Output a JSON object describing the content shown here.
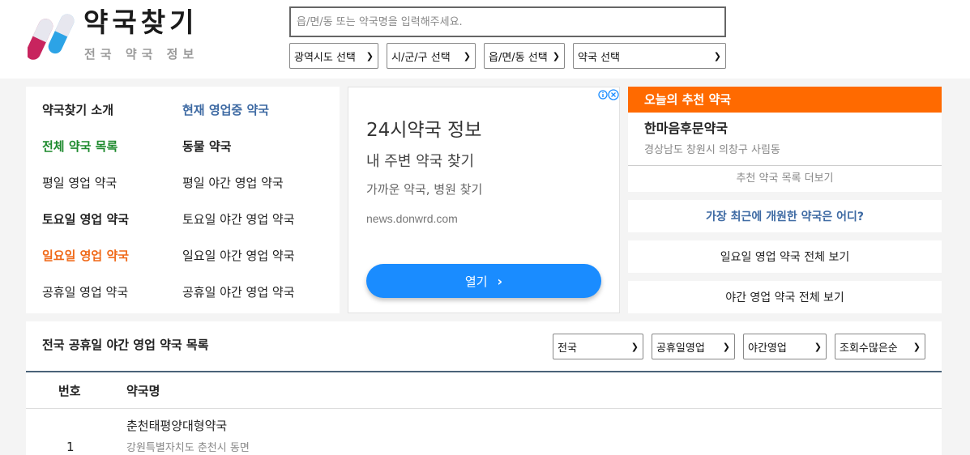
{
  "header": {
    "logo_title": "약국찾기",
    "logo_sub": "전국 약국 정보",
    "search_placeholder": "읍/면/동 또는 약국명을 입력해주세요.",
    "selects": [
      "광역시도 선택",
      "시/군/구 선택",
      "읍/면/동 선택",
      "약국 선택"
    ]
  },
  "menu": {
    "items": [
      {
        "label": "약국찾기 소개"
      },
      {
        "label": "현재 영업중 약국"
      },
      {
        "label": "전체 약국 목록"
      },
      {
        "label": "동물 약국"
      },
      {
        "label": "평일 영업 약국"
      },
      {
        "label": "평일 야간 영업 약국"
      },
      {
        "label": "토요일 영업 약국"
      },
      {
        "label": "토요일 야간 영업 약국"
      },
      {
        "label": "일요일 영업 약국"
      },
      {
        "label": "일요일 야간 영업 약국"
      },
      {
        "label": "공휴일 영업 약국"
      },
      {
        "label": "공휴일 야간 영업 약국"
      }
    ]
  },
  "ad": {
    "title": "24시약국 정보",
    "subtitle": "내 주변 약국 찾기",
    "subtitle2": "가까운 약국, 병원 찾기",
    "url": "news.donwrd.com",
    "button": "열기"
  },
  "recommend": {
    "heading": "오늘의 추천 약국",
    "name": "한마음후문약국",
    "address": "경상남도 창원시 의창구 사림동",
    "more": "추천 약국 목록 더보기"
  },
  "side_links": [
    {
      "label": "가장 최근에 개원한 약국은 어디?"
    },
    {
      "label": "일요일 영업 약국 전체 보기"
    },
    {
      "label": "야간 영업 약국 전체 보기"
    }
  ],
  "list": {
    "title": "전국 공휴일 야간 영업 약국 목록",
    "filters": [
      "전국",
      "공휴일영업",
      "야간영업",
      "조회수많은순"
    ],
    "col_num": "번호",
    "col_name": "약국명",
    "rows": [
      {
        "num": "1",
        "name": "춘천태평양대형약국",
        "address": "강원특별자치도 춘천시 동면"
      }
    ]
  },
  "colors": {
    "accent_orange": "#ff6a00",
    "link_blue": "#3e6aa3",
    "link_green": "#1e8a2e",
    "link_orange": "#f06a1a",
    "ad_blue": "#1a8cff"
  }
}
